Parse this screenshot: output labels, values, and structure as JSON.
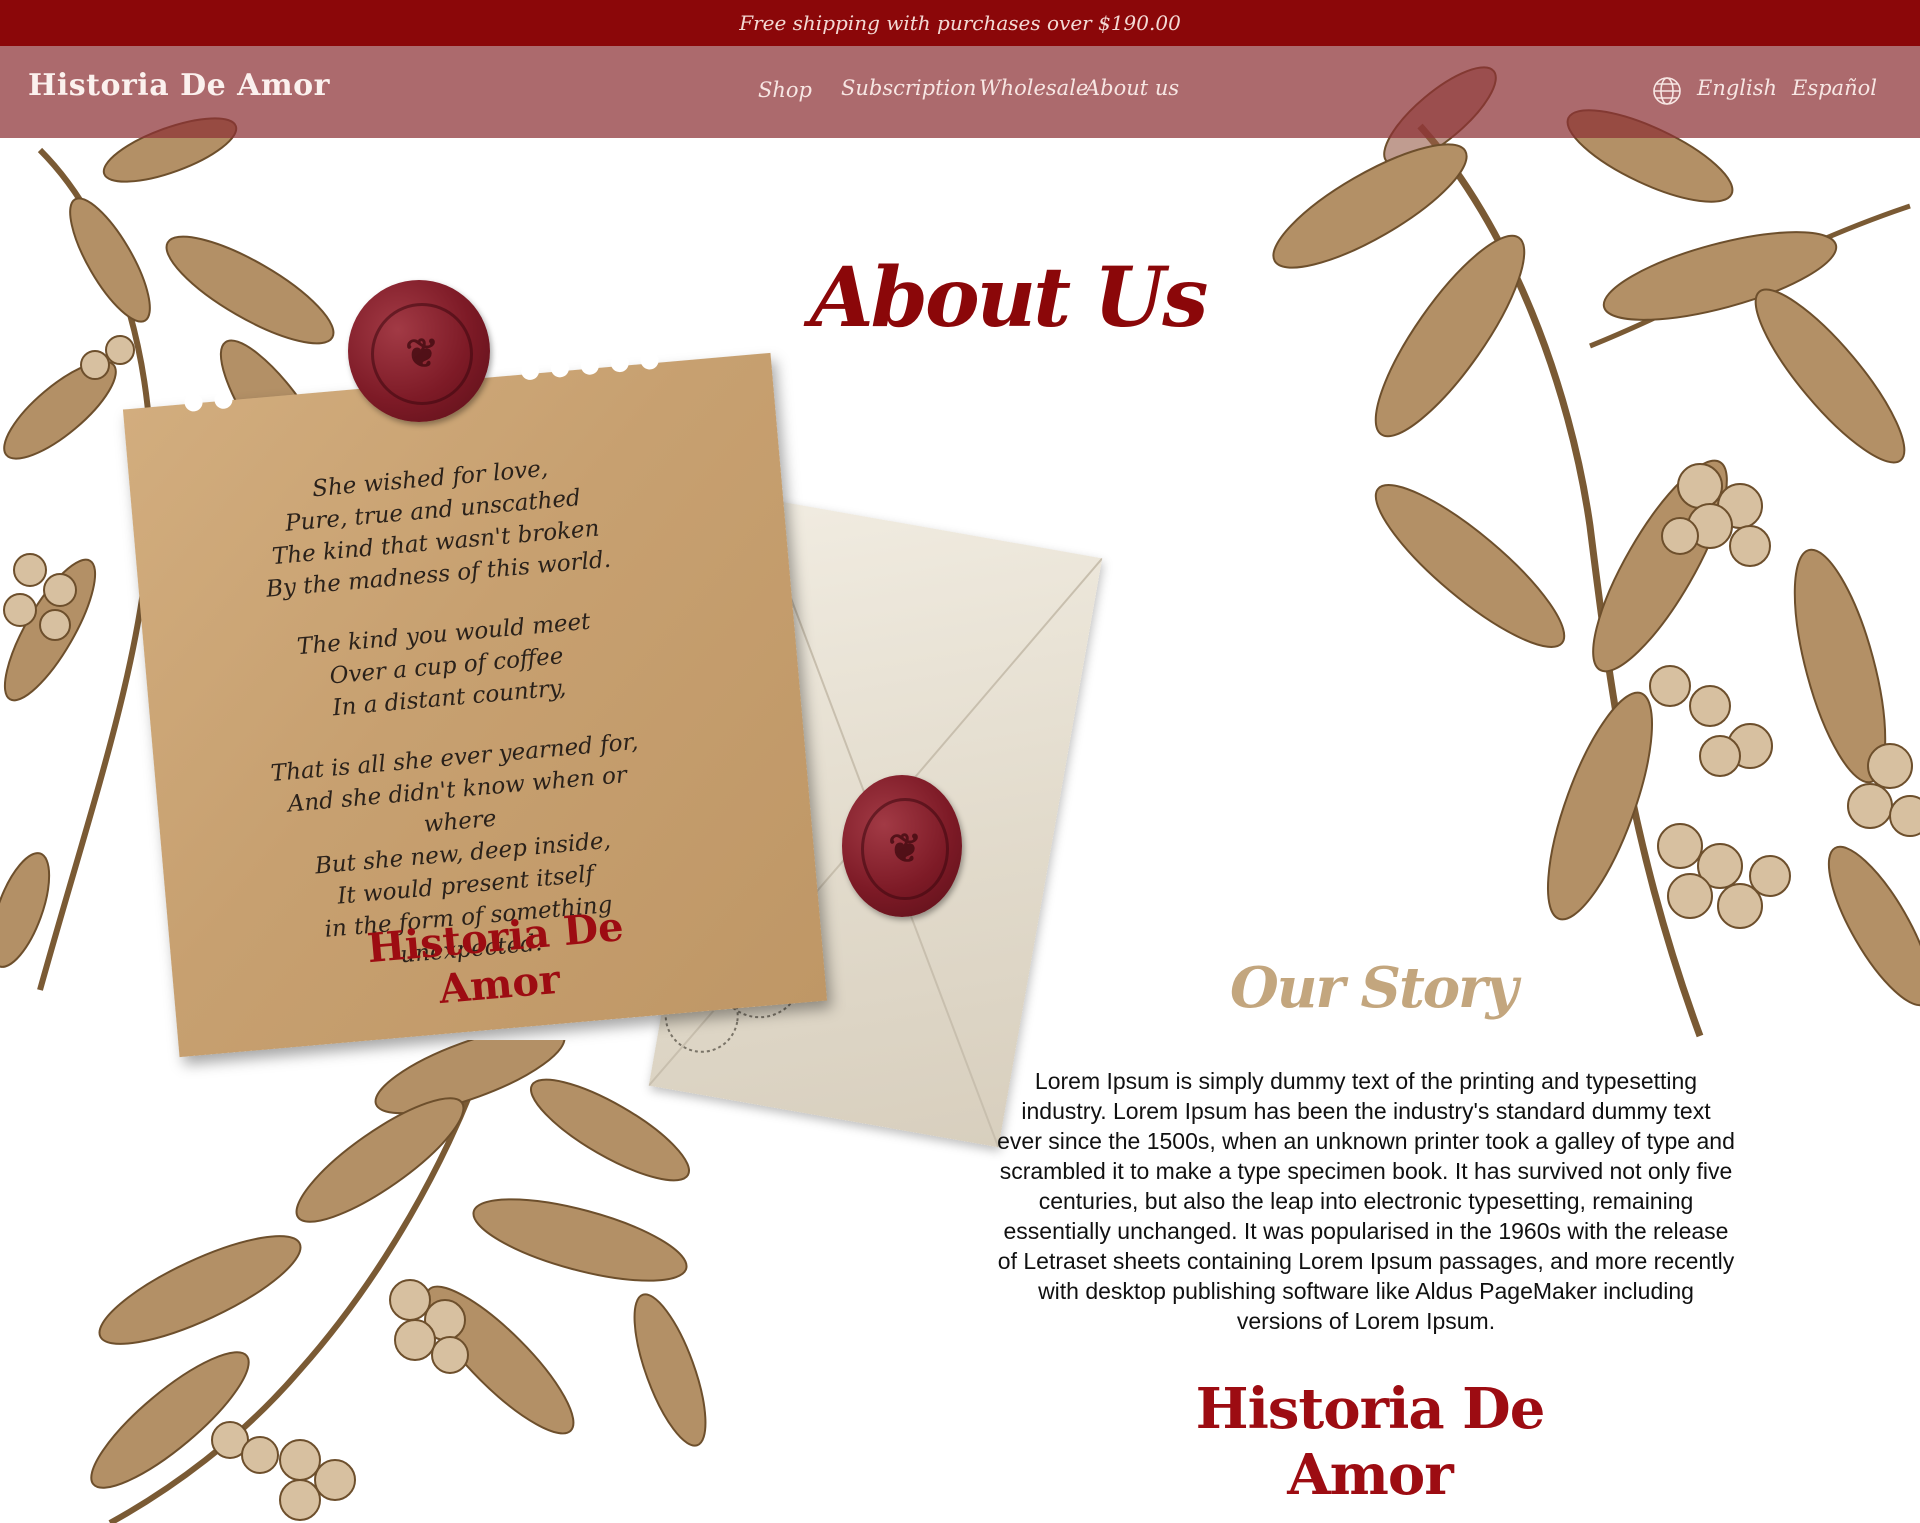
{
  "announcement": "Free shipping with purchases over $190.00",
  "brand": "Historia De Amor",
  "nav": {
    "links": [
      "Shop",
      "Subscription",
      "Wholesale",
      "About us"
    ],
    "languages": [
      "English",
      "Español"
    ]
  },
  "hero": {
    "title": "About Us"
  },
  "poem": {
    "stanzas": [
      [
        "She wished for love,",
        "Pure, true and unscathed",
        "The kind that wasn't broken",
        "By the madness of this world."
      ],
      [
        "The kind you would meet",
        "Over a cup of coffee",
        "In a distant country,"
      ],
      [
        "That is all she ever yearned for,",
        "And she didn't know when or where",
        "But she new, deep inside,",
        "It would present itself",
        "in the form of something",
        "unexpected."
      ]
    ],
    "signature": "Historia De Amor"
  },
  "story": {
    "title": "Our Story",
    "body": "Lorem Ipsum is simply dummy text of the printing and typesetting industry. Lorem Ipsum has been the industry's standard dummy text ever since the 1500s, when an unknown printer took a galley of type and scrambled it to make a type specimen book. It has survived not only five centuries, but also the leap into electronic typesetting, remaining essentially unchanged. It was popularised in the 1960s with the release of Letraset sheets containing Lorem Ipsum passages, and more recently with desktop publishing software like Aldus PageMaker including versions of Lorem Ipsum.",
    "signature": "Historia De Amor"
  },
  "colors": {
    "brand_red": "#8b0709",
    "nav_bg": "#a46a6c",
    "kraft": "#c7a070",
    "botanical": "#9b7548",
    "story_title": "#c3a67e"
  },
  "icons": [
    "globe-icon",
    "wax-seal-icon",
    "coffee-branch-illustration",
    "envelope-illustration"
  ]
}
